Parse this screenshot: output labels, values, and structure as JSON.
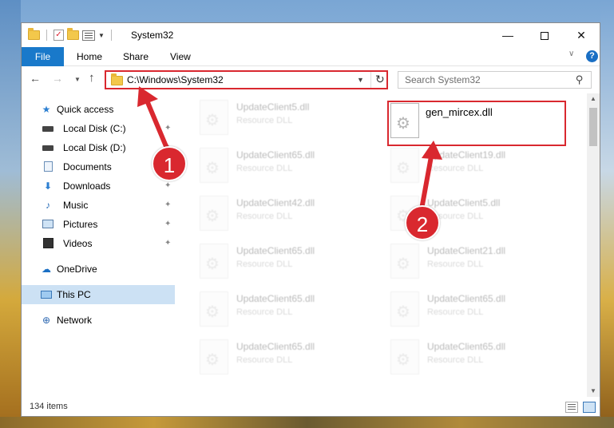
{
  "window": {
    "title": "System32",
    "controls": {
      "minimize": "—",
      "maximize": "",
      "close": "✕"
    }
  },
  "ribbon": {
    "file": "File",
    "tabs": [
      "Home",
      "Share",
      "View"
    ],
    "help": "?"
  },
  "navigation": {
    "address": "C:\\Windows\\System32",
    "search_placeholder": "Search System32"
  },
  "sidebar": {
    "items": [
      {
        "label": "Quick access",
        "icon": "star-icon",
        "pinned": false
      },
      {
        "label": "Local Disk (C:)",
        "icon": "drive-icon",
        "pinned": true
      },
      {
        "label": "Local Disk (D:)",
        "icon": "drive-icon",
        "pinned": true
      },
      {
        "label": "Documents",
        "icon": "documents-icon",
        "pinned": true
      },
      {
        "label": "Downloads",
        "icon": "downloads-icon",
        "pinned": true
      },
      {
        "label": "Music",
        "icon": "music-icon",
        "pinned": true
      },
      {
        "label": "Pictures",
        "icon": "pictures-icon",
        "pinned": true
      },
      {
        "label": "Videos",
        "icon": "videos-icon",
        "pinned": true
      },
      {
        "label": "OneDrive",
        "icon": "cloud-icon",
        "pinned": false
      },
      {
        "label": "This PC",
        "icon": "computer-icon",
        "pinned": false,
        "selected": true
      },
      {
        "label": "Network",
        "icon": "network-icon",
        "pinned": false
      }
    ]
  },
  "files": {
    "highlighted": {
      "name": "gen_mircex.dll",
      "type": ""
    },
    "left_column": [
      {
        "name": "UpdateClient5.dll",
        "type": "Resource DLL"
      },
      {
        "name": "UpdateClient65.dll",
        "type": "Resource DLL"
      },
      {
        "name": "UpdateClient42.dll",
        "type": "Resource DLL"
      },
      {
        "name": "UpdateClient65.dll",
        "type": "Resource DLL"
      },
      {
        "name": "UpdateClient65.dll",
        "type": "Resource DLL"
      },
      {
        "name": "UpdateClient65.dll",
        "type": "Resource DLL"
      }
    ],
    "right_column": [
      {
        "name": "UpdateClient19.dll",
        "type": "Resource DLL"
      },
      {
        "name": "UpdateClient5.dll",
        "type": "Resource DLL"
      },
      {
        "name": "UpdateClient21.dll",
        "type": "Resource DLL"
      },
      {
        "name": "UpdateClient65.dll",
        "type": "Resource DLL"
      },
      {
        "name": "UpdateClient65.dll",
        "type": "Resource DLL"
      }
    ]
  },
  "status": {
    "item_count": "134 items"
  },
  "annotations": {
    "step1": "1",
    "step2": "2",
    "highlight_color": "#d9282f"
  }
}
